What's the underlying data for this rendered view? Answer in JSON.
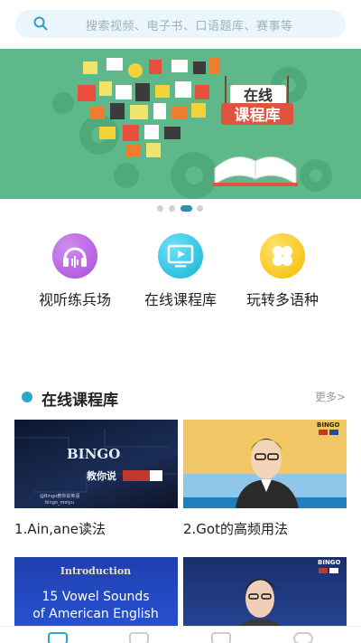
{
  "search": {
    "placeholder": "搜索视频、电子书、口语题库、赛事等"
  },
  "banner": {
    "title_line1": "在线",
    "title_line2": "课程库",
    "page_count": 4,
    "active_page": 3
  },
  "features": [
    {
      "label": "视听练兵场",
      "icon": "headphones-icon",
      "color": "#b65ee0"
    },
    {
      "label": "在线课程库",
      "icon": "monitor-play-icon",
      "color": "#1cc2e3"
    },
    {
      "label": "玩转多语种",
      "icon": "clover-icon",
      "color": "#f7c514"
    }
  ],
  "section": {
    "title": "在线课程库",
    "more": "更多>"
  },
  "courses": [
    {
      "title": "1.Ain,ane读法",
      "thumb_text1": "BINGO",
      "thumb_text2": "教你说",
      "thumb_text3": "@Bingo教你说英语",
      "thumb_text4": "bingo_meiyu"
    },
    {
      "title": "2.Got的高频用法",
      "thumb_text1": "BINGO"
    },
    {
      "title": "",
      "thumb_text1": "Introduction",
      "thumb_text2": "15 Vowel Sounds",
      "thumb_text3": "of American English"
    },
    {
      "title": "",
      "thumb_text1": "BINGO"
    }
  ],
  "colors": {
    "accent": "#2aa6c7",
    "banner_bg": "#5fb88a",
    "search_bg": "#eaf6fb"
  }
}
